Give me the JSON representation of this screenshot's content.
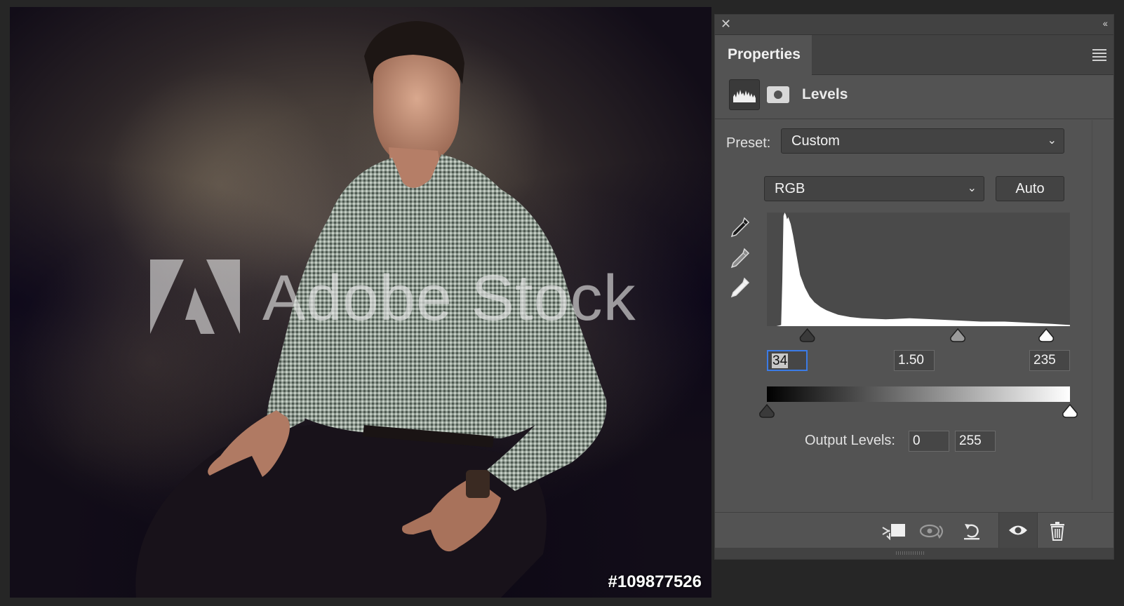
{
  "image": {
    "watermark_text": "Adobe Stock",
    "stock_id": "#109877526"
  },
  "panel": {
    "close_icon": "close-icon",
    "collapse_icon": "collapse-panel-icon",
    "tab_title": "Properties",
    "menu_icon": "panel-menu-icon",
    "adjustment_type": "Levels",
    "preset_label": "Preset:",
    "preset_value": "Custom",
    "channel_value": "RGB",
    "auto_label": "Auto",
    "eyedroppers": [
      "black-point-eyedropper-icon",
      "gray-point-eyedropper-icon",
      "white-point-eyedropper-icon"
    ],
    "input_levels": {
      "black": "34",
      "gamma": "1.50",
      "white": "235"
    },
    "output_label": "Output Levels:",
    "output_levels": {
      "black": "0",
      "white": "255"
    },
    "bottom_icons": [
      "clip-to-layer-icon",
      "view-previous-state-icon",
      "reset-icon",
      "visibility-eye-icon",
      "trash-icon"
    ]
  },
  "chart_data": {
    "type": "area",
    "description_source": "levels histogram",
    "x": [
      0,
      8,
      12,
      13,
      14,
      15,
      16,
      17,
      18,
      20,
      22,
      25,
      28,
      32,
      36,
      40,
      45,
      50,
      55,
      60,
      70,
      80,
      100,
      120,
      140,
      160,
      180,
      200,
      220,
      240,
      255
    ],
    "values": [
      0,
      0,
      1,
      40,
      97,
      100,
      98,
      94,
      96,
      90,
      80,
      62,
      45,
      34,
      26,
      21,
      17,
      14,
      12,
      10,
      8,
      7,
      6,
      7,
      6,
      5,
      4,
      4,
      3,
      2,
      1
    ],
    "xlim": [
      0,
      255
    ],
    "ylim": [
      0,
      100
    ],
    "input_slider_values": [
      34,
      1.5,
      235
    ],
    "output_slider_values": [
      0,
      255
    ]
  }
}
